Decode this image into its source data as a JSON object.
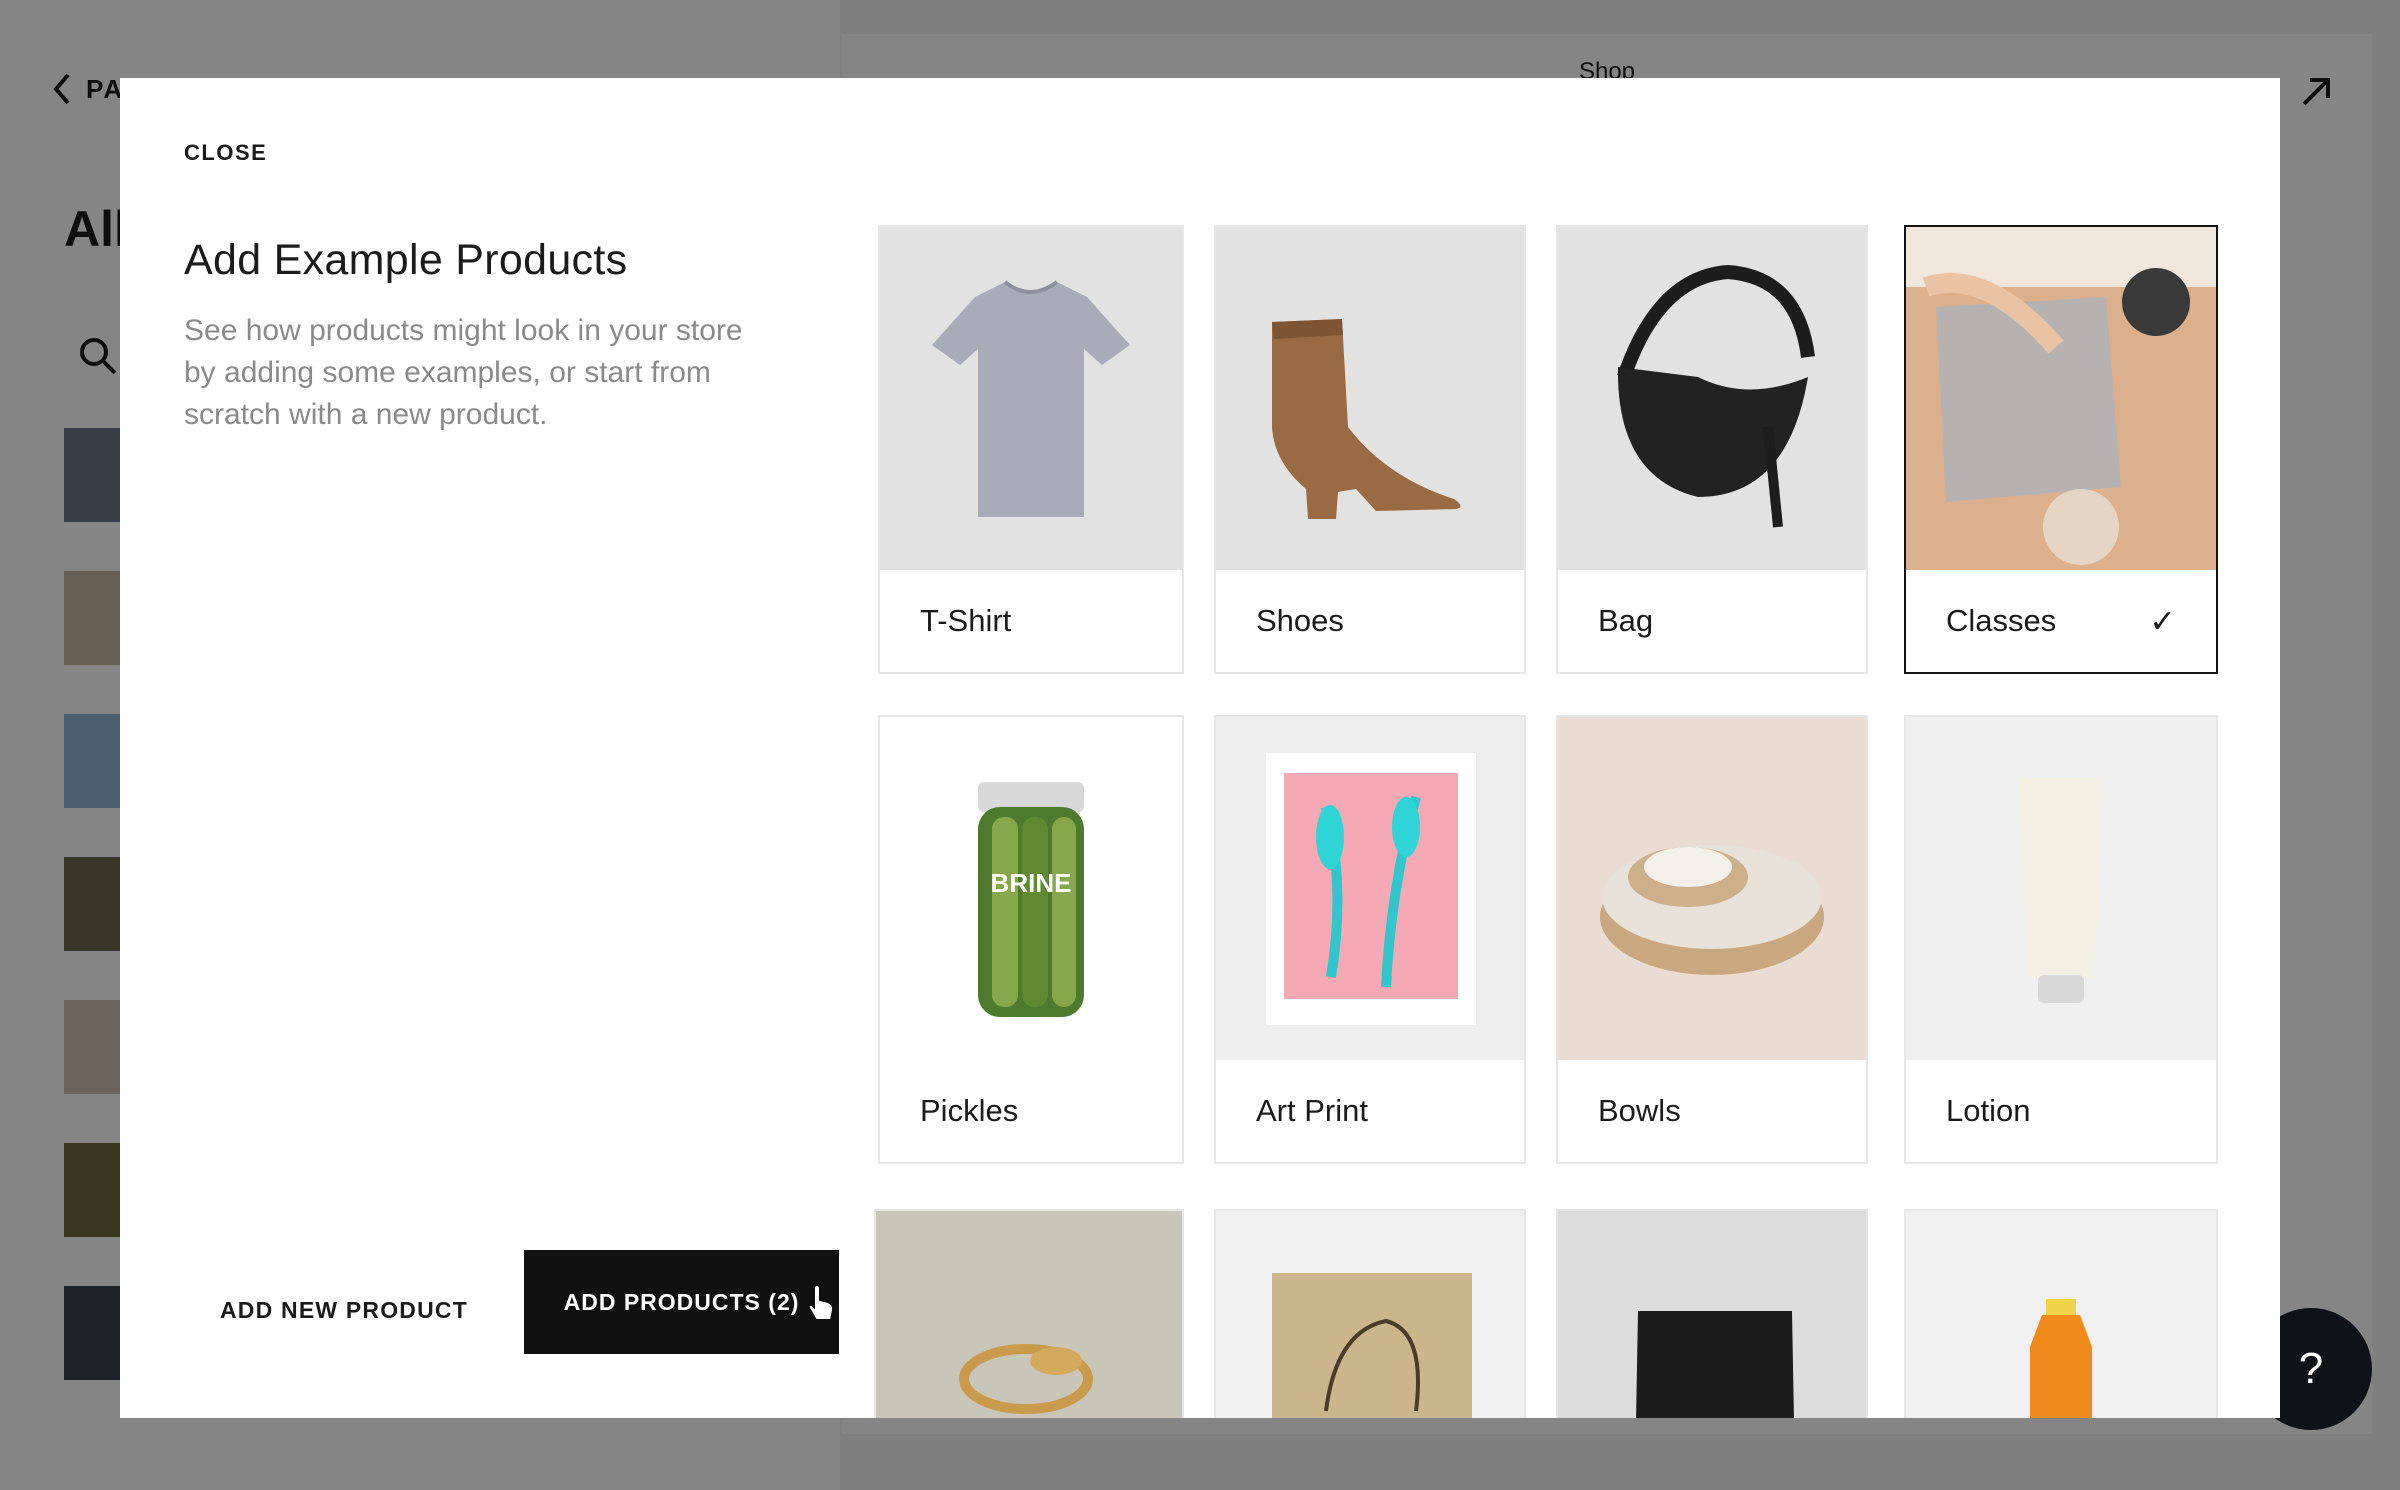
{
  "background": {
    "back_label": "PA",
    "page_title": "All",
    "preview_title": "Shop",
    "help_label": "?"
  },
  "modal": {
    "close_label": "CLOSE",
    "title": "Add Example Products",
    "description": "See how products might look in your store by adding some examples, or start from scratch with a new product.",
    "add_new_label": "ADD NEW PRODUCT",
    "add_products_label": "ADD PRODUCTS (2)"
  },
  "products": [
    {
      "label": "T-Shirt",
      "selected": false
    },
    {
      "label": "Shoes",
      "selected": false
    },
    {
      "label": "Bag",
      "selected": false
    },
    {
      "label": "Classes",
      "selected": true,
      "check": "✓"
    },
    {
      "label": "Pickles",
      "selected": false
    },
    {
      "label": "Art Print",
      "selected": false
    },
    {
      "label": "Bowls",
      "selected": false
    },
    {
      "label": "Lotion",
      "selected": false
    },
    {
      "label": "",
      "selected": false
    },
    {
      "label": "",
      "selected": false
    },
    {
      "label": "",
      "selected": false
    },
    {
      "label": "",
      "selected": false
    }
  ],
  "colors": {
    "overlay": "#7f7f7f",
    "primary_button": "#111111",
    "selected_border": "#141414",
    "muted_text": "#8a8a8a"
  }
}
